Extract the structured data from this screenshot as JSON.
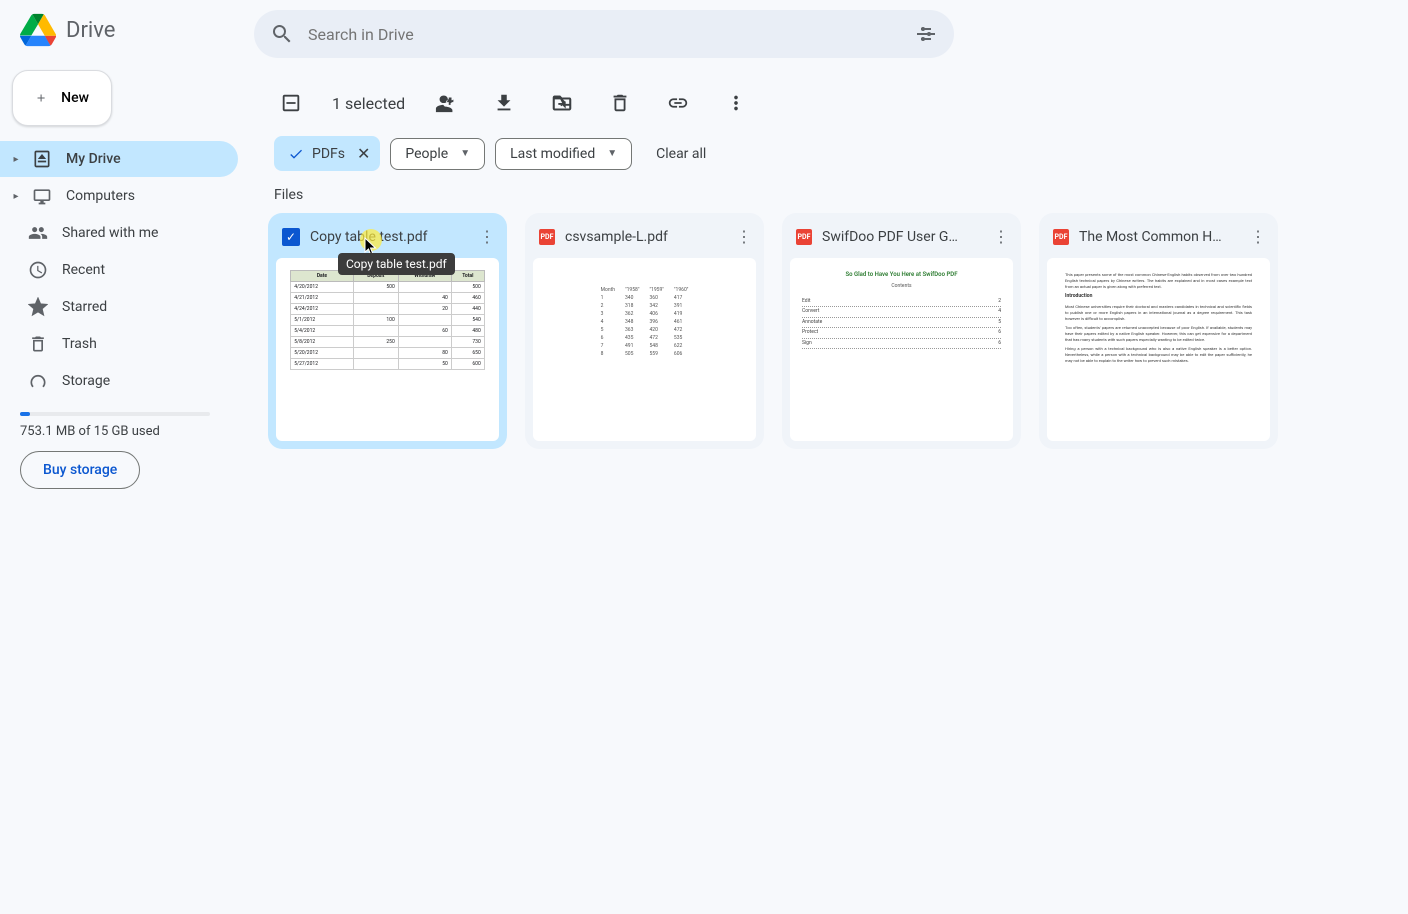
{
  "app": {
    "name": "Drive"
  },
  "search": {
    "placeholder": "Search in Drive"
  },
  "newButton": {
    "label": "New"
  },
  "sidebar": {
    "items": [
      {
        "id": "mydrive",
        "label": "My Drive",
        "active": true
      },
      {
        "id": "computers",
        "label": "Computers"
      },
      {
        "id": "shared",
        "label": "Shared with me"
      },
      {
        "id": "recent",
        "label": "Recent"
      },
      {
        "id": "starred",
        "label": "Starred"
      },
      {
        "id": "trash",
        "label": "Trash"
      },
      {
        "id": "storage",
        "label": "Storage"
      }
    ]
  },
  "storage": {
    "used": "753.1 MB of 15 GB used",
    "buy": "Buy storage"
  },
  "toolbar": {
    "selected": "1 selected"
  },
  "filters": {
    "type": {
      "label": "PDFs"
    },
    "people": {
      "label": "People"
    },
    "modified": {
      "label": "Last modified"
    },
    "clear": "Clear all"
  },
  "sections": {
    "files": "Files"
  },
  "files": [
    {
      "name": "Copy table test.pdf",
      "selected": true,
      "kind": "table"
    },
    {
      "name": "csvsample-L.pdf",
      "selected": false,
      "kind": "csv"
    },
    {
      "name": "SwifDoo PDF User G…",
      "selected": false,
      "kind": "guide"
    },
    {
      "name": "The Most Common H…",
      "selected": false,
      "kind": "doc"
    }
  ],
  "tooltip": {
    "text": "Copy table test.pdf"
  },
  "pdfBadge": "PDF",
  "thumbs": {
    "guide": {
      "title": "So Glad to Have You Here at SwifDoo PDF",
      "contents": "Contents",
      "toc": [
        [
          "Edit",
          "2"
        ],
        [
          "Convert",
          "4"
        ],
        [
          "Annotate",
          "5"
        ],
        [
          "Protect",
          "6"
        ],
        [
          "Sign",
          "6"
        ]
      ]
    },
    "doc": {
      "h1": "Introduction"
    }
  }
}
